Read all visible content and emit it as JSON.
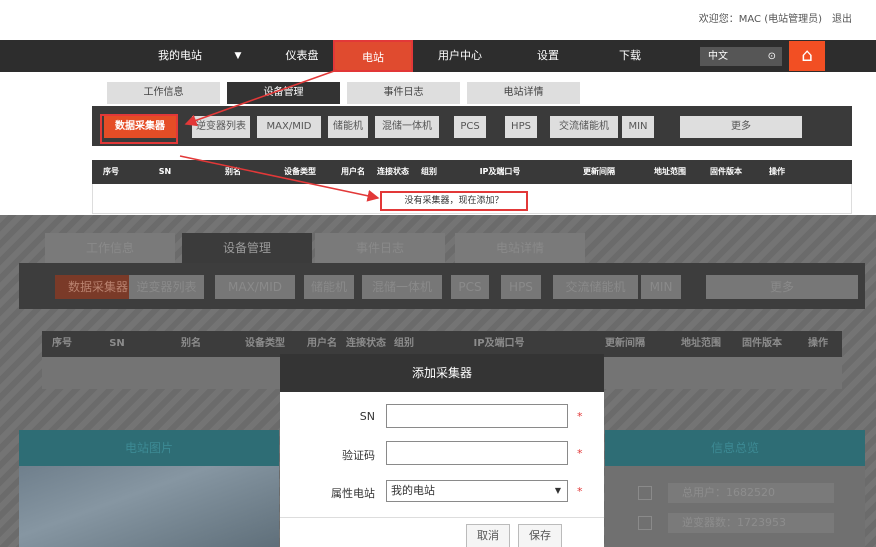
{
  "header": {
    "welcome": "欢迎您：MAC (电站管理员)",
    "logout": "退出"
  },
  "nav": {
    "items": [
      "我的电站",
      "仪表盘",
      "电站",
      "用户中心",
      "设置",
      "下载"
    ],
    "dropdown_glyph": "▼",
    "lang": "中文",
    "lang_icon": "⊙",
    "home_icon": "home-icon"
  },
  "tabs": [
    "工作信息",
    "设备管理",
    "事件日志",
    "电站详情"
  ],
  "subtabs": [
    "数据采集器",
    "逆变器列表",
    "MAX/MID",
    "储能机",
    "混储一体机",
    "PCS",
    "HPS",
    "交流储能机",
    "MIN",
    "更多"
  ],
  "table": {
    "headers": [
      "序号",
      "SN",
      "别名",
      "设备类型",
      "用户名",
      "连接状态",
      "组别",
      "IP及端口号",
      "更新间隔",
      "地址范围",
      "固件版本",
      "操作"
    ],
    "headers2": [
      "序号",
      "SN",
      "别名",
      "设备类型",
      "用户名",
      "连接状态",
      "组别",
      "IP及端口号",
      "更新间隔",
      "地址范围",
      "固件版本",
      "操作"
    ],
    "no_data": "没有采集器，现在添加？"
  },
  "cards": {
    "photo_title": "电站图片",
    "info_title": "信息总览",
    "info_rows": [
      {
        "label": "总用户：",
        "value": "1682520"
      },
      {
        "label": "逆变器数：",
        "value": "1723953"
      }
    ]
  },
  "dialog": {
    "title": "添加采集器",
    "sn_label": "SN",
    "code_label": "验证码",
    "plant_label": "属性电站",
    "plant_value": "我的电站",
    "required": "*",
    "cancel": "取消",
    "save": "保存"
  },
  "colors": {
    "accent": "#e54d26",
    "nav_bg": "#2d2d2d",
    "annotation": "#e23838"
  }
}
